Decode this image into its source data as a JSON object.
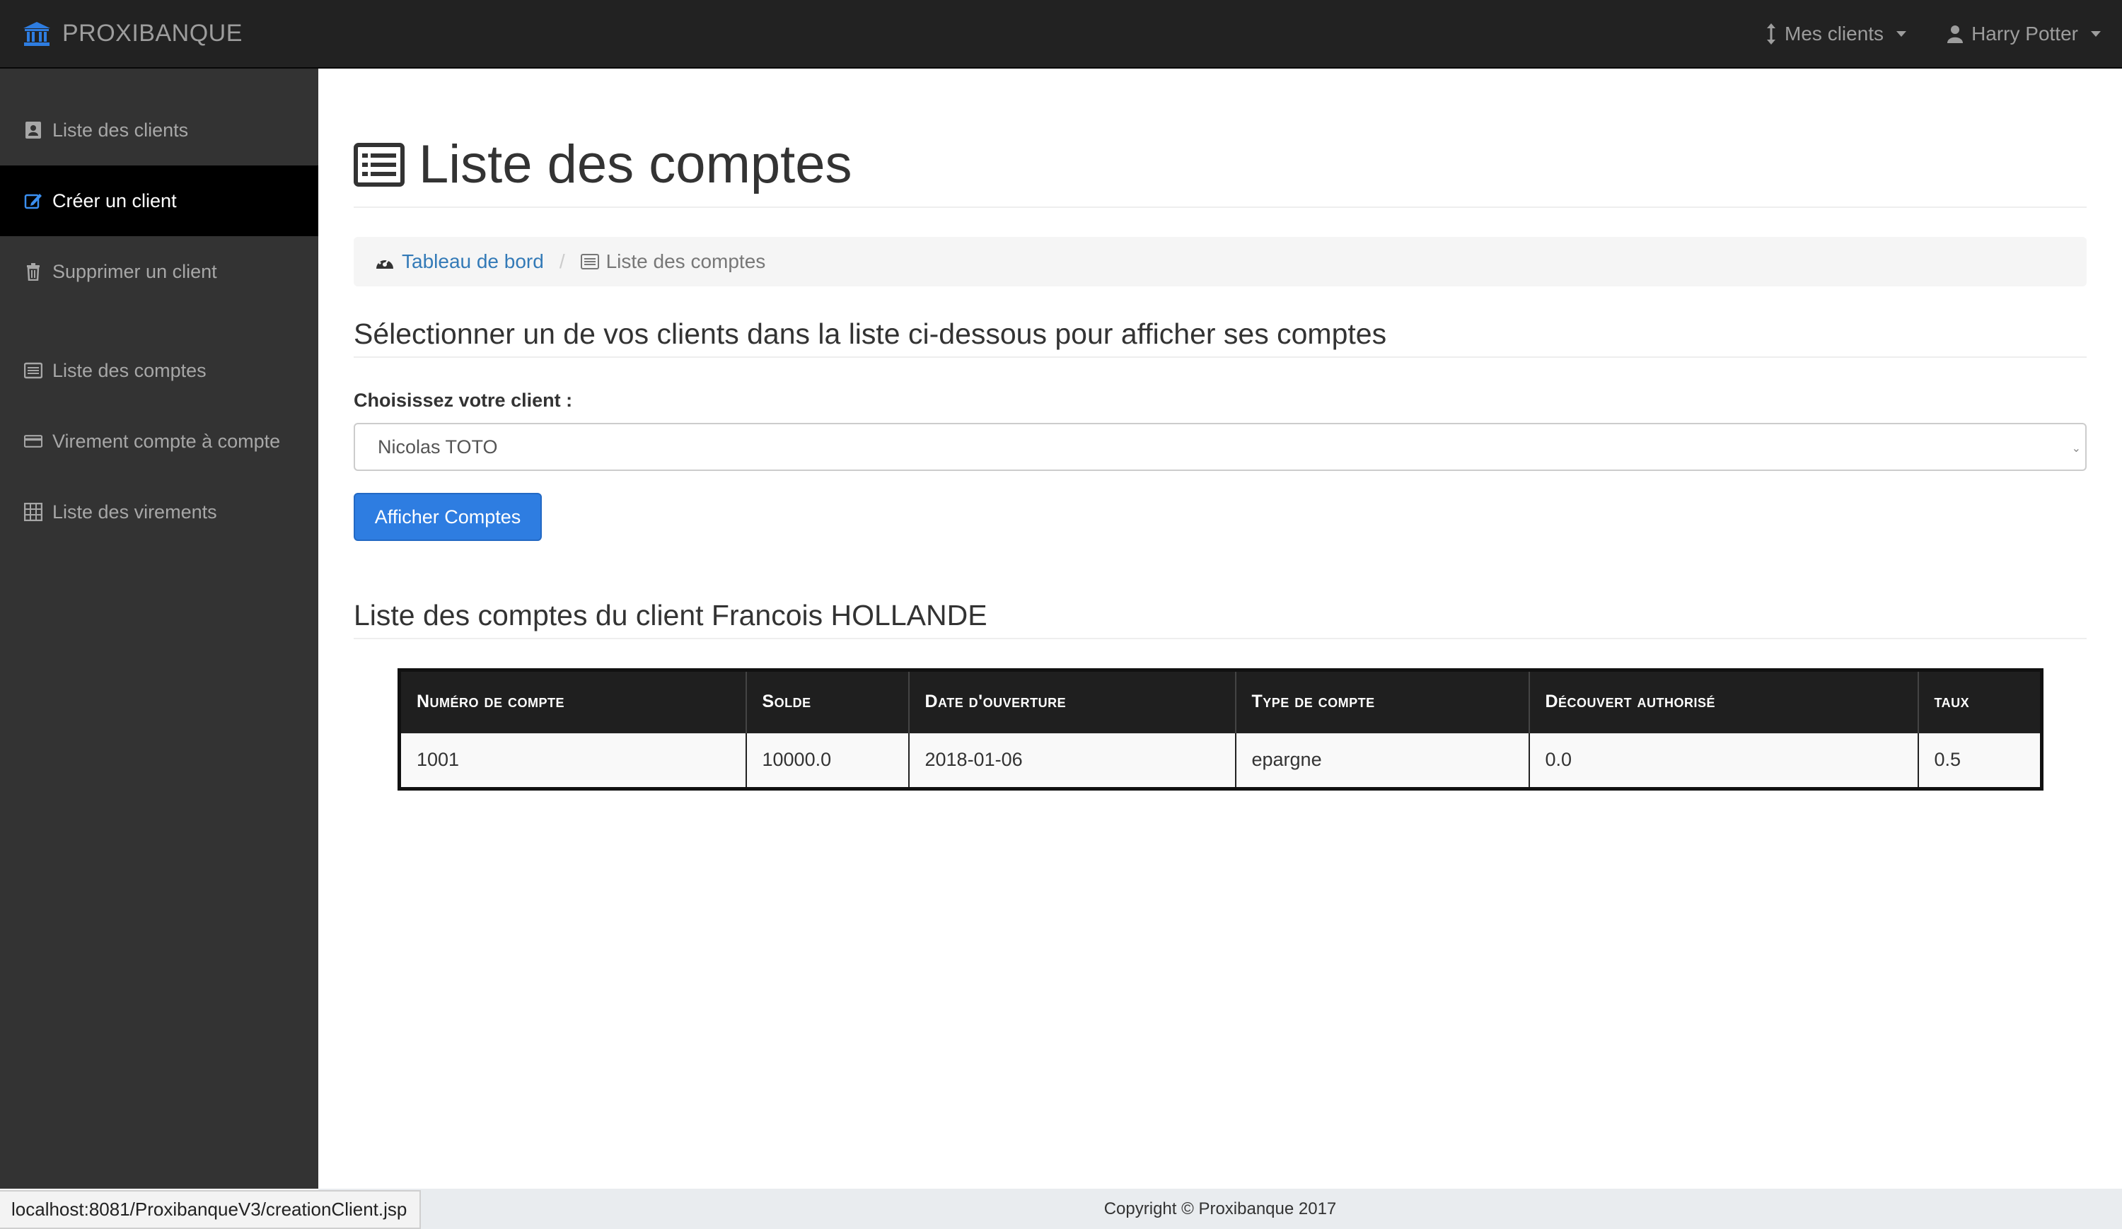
{
  "navbar": {
    "brand": "PROXIBANQUE",
    "brand_icon": "bank-icon",
    "clients_menu": "Mes clients",
    "clients_icon": "sort-vertical-icon",
    "user_menu": "Harry Potter",
    "user_icon": "user-icon"
  },
  "sidebar": {
    "items": [
      {
        "label": "Liste des clients",
        "icon": "contact-card-icon"
      },
      {
        "label": "Créer un client",
        "icon": "edit-icon",
        "active": true
      },
      {
        "label": "Supprimer un client",
        "icon": "trash-icon"
      },
      {
        "label": "Liste des comptes",
        "icon": "list-alt-icon"
      },
      {
        "label": "Virement compte à compte",
        "icon": "credit-card-icon"
      },
      {
        "label": "Liste des virements",
        "icon": "table-icon"
      }
    ]
  },
  "main": {
    "title": "Liste des comptes",
    "breadcrumb": {
      "home": "Tableau de bord",
      "separator": "/",
      "current": "Liste des comptes"
    },
    "select_heading": "Sélectionner un de vos clients dans la liste ci-dessous pour afficher ses comptes",
    "form_label": "Choisissez votre client :",
    "selected_client": "Nicolas TOTO",
    "submit_label": "Afficher Comptes",
    "accounts_heading": "Liste des comptes du client Francois HOLLANDE",
    "table": {
      "headers": [
        "Numéro de compte",
        "Solde",
        "Date d'ouverture",
        "Type de compte",
        "Découvert authorisé",
        "taux"
      ],
      "rows": [
        [
          "1001",
          "10000.0",
          "2018-01-06",
          "epargne",
          "0.0",
          "0.5"
        ]
      ]
    }
  },
  "footer": {
    "copyright": "Copyright © Proxibanque 2017"
  },
  "status_bar": {
    "url": "localhost:8081/ProxibanqueV3/creationClient.jsp"
  },
  "colors": {
    "navbar_bg": "#222222",
    "sidebar_bg": "#333333",
    "active_item_bg": "#000000",
    "primary_button": "#2e7de1",
    "link": "#337ab7"
  }
}
